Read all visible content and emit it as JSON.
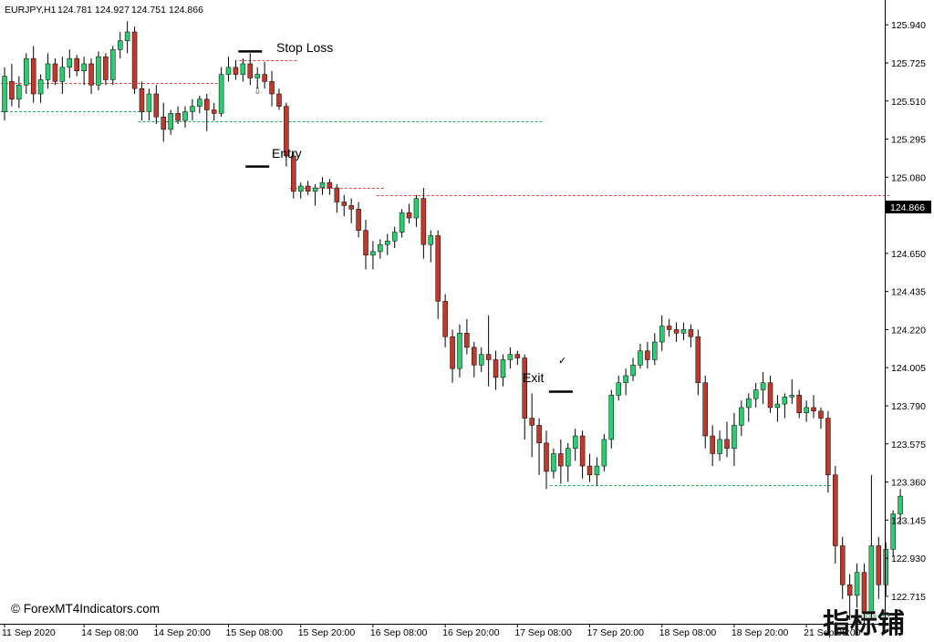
{
  "header": {
    "symbol": "EURJPY,H1",
    "open": "124.781",
    "high": "124.927",
    "low": "124.751",
    "close": "124.866"
  },
  "current_price": "124.866",
  "annotations": {
    "stop_loss": "Stop Loss",
    "entry": "Entry",
    "exit": "Exit"
  },
  "copyright": "© ForexMT4Indicators.com",
  "watermark": "指标铺",
  "colors": {
    "bull": "#2ecc71",
    "bear": "#c0392b",
    "wick": "#000000",
    "resistance_line": "#e74c3c",
    "support_line": "#27ae60",
    "current_price_box": "#000000",
    "background": "#ffffff"
  },
  "chart_data": {
    "type": "candlestick",
    "symbol": "EURJPY",
    "timeframe": "H1",
    "y_tick_labels": [
      "125.940",
      "125.725",
      "125.510",
      "125.295",
      "125.080",
      "124.866",
      "124.650",
      "124.435",
      "124.220",
      "124.005",
      "123.790",
      "123.575",
      "123.360",
      "123.145",
      "122.930",
      "122.715"
    ],
    "y_ticks": [
      125.94,
      125.725,
      125.51,
      125.295,
      125.08,
      124.65,
      124.435,
      124.22,
      124.005,
      123.79,
      123.575,
      123.36,
      123.145,
      122.93,
      122.715
    ],
    "x_tick_labels": [
      "11 Sep 2020",
      "14 Sep 08:00",
      "14 Sep 20:00",
      "15 Sep 08:00",
      "15 Sep 20:00",
      "16 Sep 08:00",
      "16 Sep 20:00",
      "17 Sep 08:00",
      "17 Sep 20:00",
      "18 Sep 08:00",
      "18 Sep 20:00",
      "21 Sep 08:00"
    ],
    "x_tick_bar_index": [
      0,
      11,
      21,
      31,
      41,
      51,
      61,
      71,
      81,
      91,
      101,
      111
    ],
    "ylim": [
      122.56,
      126.08
    ],
    "levels": [
      {
        "kind": "resistance",
        "price": 125.614,
        "from_bar": 0,
        "to_bar": 29
      },
      {
        "kind": "support",
        "price": 125.451,
        "from_bar": 0,
        "to_bar": 19
      },
      {
        "kind": "support",
        "price": 125.398,
        "from_bar": 19,
        "to_bar": 74
      },
      {
        "kind": "resistance",
        "price": 125.74,
        "from_bar": 33,
        "to_bar": 40
      },
      {
        "kind": "resistance",
        "price": 125.018,
        "from_bar": 40,
        "to_bar": 52
      },
      {
        "kind": "resistance",
        "price": 124.98,
        "from_bar": 52,
        "to_bar": 122
      },
      {
        "kind": "support",
        "price": 123.343,
        "from_bar": 76,
        "to_bar": 114
      },
      {
        "kind": "support",
        "price": 122.606,
        "from_bar": 117,
        "to_bar": 122
      }
    ],
    "trade": {
      "stop_loss_bar": 34,
      "stop_loss_price": 125.79,
      "entry_bar": 35,
      "entry_price": 125.14,
      "exit_bar": 77,
      "exit_price": 123.87
    },
    "ohlc": [
      [
        125.45,
        125.7,
        125.4,
        125.65
      ],
      [
        125.62,
        125.72,
        125.48,
        125.52
      ],
      [
        125.52,
        125.65,
        125.47,
        125.6
      ],
      [
        125.6,
        125.78,
        125.55,
        125.75
      ],
      [
        125.75,
        125.82,
        125.5,
        125.55
      ],
      [
        125.55,
        125.66,
        125.5,
        125.63
      ],
      [
        125.63,
        125.78,
        125.58,
        125.72
      ],
      [
        125.72,
        125.75,
        125.6,
        125.62
      ],
      [
        125.62,
        125.76,
        125.55,
        125.7
      ],
      [
        125.7,
        125.8,
        125.64,
        125.75
      ],
      [
        125.75,
        125.77,
        125.65,
        125.68
      ],
      [
        125.68,
        125.76,
        125.6,
        125.72
      ],
      [
        125.72,
        125.75,
        125.55,
        125.6
      ],
      [
        125.6,
        125.79,
        125.57,
        125.76
      ],
      [
        125.76,
        125.78,
        125.6,
        125.63
      ],
      [
        125.63,
        125.82,
        125.6,
        125.8
      ],
      [
        125.8,
        125.9,
        125.75,
        125.85
      ],
      [
        125.85,
        125.96,
        125.78,
        125.9
      ],
      [
        125.9,
        125.93,
        125.55,
        125.58
      ],
      [
        125.58,
        125.62,
        125.4,
        125.45
      ],
      [
        125.45,
        125.58,
        125.4,
        125.55
      ],
      [
        125.55,
        125.6,
        125.38,
        125.42
      ],
      [
        125.42,
        125.5,
        125.28,
        125.35
      ],
      [
        125.35,
        125.46,
        125.32,
        125.44
      ],
      [
        125.44,
        125.48,
        125.38,
        125.4
      ],
      [
        125.4,
        125.48,
        125.36,
        125.45
      ],
      [
        125.45,
        125.52,
        125.4,
        125.48
      ],
      [
        125.48,
        125.54,
        125.44,
        125.52
      ],
      [
        125.52,
        125.55,
        125.34,
        125.46
      ],
      [
        125.46,
        125.5,
        125.4,
        125.44
      ],
      [
        125.44,
        125.7,
        125.42,
        125.66
      ],
      [
        125.66,
        125.76,
        125.62,
        125.7
      ],
      [
        125.7,
        125.74,
        125.63,
        125.66
      ],
      [
        125.66,
        125.75,
        125.62,
        125.72
      ],
      [
        125.72,
        125.78,
        125.6,
        125.64
      ],
      [
        125.64,
        125.7,
        125.58,
        125.66
      ],
      [
        125.66,
        125.73,
        125.58,
        125.62
      ],
      [
        125.62,
        125.68,
        125.48,
        125.55
      ],
      [
        125.55,
        125.58,
        125.46,
        125.48
      ],
      [
        125.48,
        125.5,
        125.14,
        125.2
      ],
      [
        125.2,
        125.22,
        124.96,
        125.0
      ],
      [
        125.0,
        125.05,
        124.96,
        125.03
      ],
      [
        125.03,
        125.06,
        124.98,
        125.0
      ],
      [
        125.0,
        125.04,
        124.92,
        125.02
      ],
      [
        125.02,
        125.08,
        124.98,
        125.05
      ],
      [
        125.05,
        125.07,
        124.98,
        125.02
      ],
      [
        125.02,
        125.04,
        124.88,
        124.94
      ],
      [
        124.94,
        124.98,
        124.86,
        124.92
      ],
      [
        124.92,
        124.96,
        124.82,
        124.9
      ],
      [
        124.9,
        124.94,
        124.74,
        124.78
      ],
      [
        124.78,
        124.84,
        124.56,
        124.64
      ],
      [
        124.64,
        124.72,
        124.56,
        124.66
      ],
      [
        124.66,
        124.73,
        124.62,
        124.7
      ],
      [
        124.7,
        124.76,
        124.64,
        124.72
      ],
      [
        124.72,
        124.8,
        124.68,
        124.77
      ],
      [
        124.77,
        124.9,
        124.74,
        124.88
      ],
      [
        124.88,
        124.93,
        124.82,
        124.85
      ],
      [
        124.85,
        124.98,
        124.8,
        124.96
      ],
      [
        124.96,
        125.02,
        124.62,
        124.7
      ],
      [
        124.7,
        124.78,
        124.6,
        124.75
      ],
      [
        124.75,
        124.78,
        124.28,
        124.38
      ],
      [
        124.38,
        124.42,
        124.12,
        124.18
      ],
      [
        124.18,
        124.22,
        123.92,
        124.0
      ],
      [
        124.0,
        124.25,
        123.95,
        124.2
      ],
      [
        124.2,
        124.28,
        124.08,
        124.12
      ],
      [
        124.12,
        124.15,
        123.95,
        124.02
      ],
      [
        124.02,
        124.12,
        123.98,
        124.08
      ],
      [
        124.08,
        124.3,
        123.9,
        124.05
      ],
      [
        124.05,
        124.1,
        123.88,
        123.95
      ],
      [
        123.95,
        124.08,
        123.9,
        124.05
      ],
      [
        124.05,
        124.12,
        124.0,
        124.08
      ],
      [
        124.08,
        124.1,
        124.02,
        124.06
      ],
      [
        124.06,
        124.08,
        123.6,
        123.72
      ],
      [
        123.72,
        123.86,
        123.5,
        123.68
      ],
      [
        123.68,
        123.72,
        123.4,
        123.58
      ],
      [
        123.58,
        123.65,
        123.32,
        123.42
      ],
      [
        123.42,
        123.55,
        123.38,
        123.52
      ],
      [
        123.52,
        123.6,
        123.35,
        123.45
      ],
      [
        123.45,
        123.58,
        123.36,
        123.55
      ],
      [
        123.55,
        123.66,
        123.48,
        123.62
      ],
      [
        123.62,
        123.65,
        123.38,
        123.45
      ],
      [
        123.45,
        123.52,
        123.36,
        123.4
      ],
      [
        123.4,
        123.5,
        123.34,
        123.45
      ],
      [
        123.45,
        123.63,
        123.42,
        123.6
      ],
      [
        123.6,
        123.88,
        123.55,
        123.85
      ],
      [
        123.85,
        123.96,
        123.82,
        123.92
      ],
      [
        123.92,
        124.0,
        123.85,
        123.96
      ],
      [
        123.96,
        124.06,
        123.93,
        124.02
      ],
      [
        124.02,
        124.14,
        124.0,
        124.1
      ],
      [
        124.1,
        124.15,
        124.0,
        124.05
      ],
      [
        124.05,
        124.2,
        124.02,
        124.15
      ],
      [
        124.15,
        124.3,
        124.1,
        124.24
      ],
      [
        124.24,
        124.28,
        124.18,
        124.22
      ],
      [
        124.22,
        124.26,
        124.15,
        124.2
      ],
      [
        124.2,
        124.26,
        124.16,
        124.22
      ],
      [
        124.22,
        124.25,
        124.12,
        124.18
      ],
      [
        124.18,
        124.22,
        123.85,
        123.92
      ],
      [
        123.92,
        123.96,
        123.55,
        123.62
      ],
      [
        123.62,
        123.68,
        123.45,
        123.52
      ],
      [
        123.52,
        123.65,
        123.48,
        123.6
      ],
      [
        123.6,
        123.7,
        123.5,
        123.55
      ],
      [
        123.55,
        123.75,
        123.45,
        123.68
      ],
      [
        123.68,
        123.82,
        123.62,
        123.78
      ],
      [
        123.78,
        123.86,
        123.7,
        123.83
      ],
      [
        123.83,
        123.92,
        123.78,
        123.88
      ],
      [
        123.88,
        123.98,
        123.8,
        123.92
      ],
      [
        123.92,
        123.96,
        123.75,
        123.78
      ],
      [
        123.78,
        123.85,
        123.7,
        123.8
      ],
      [
        123.8,
        123.86,
        123.72,
        123.84
      ],
      [
        123.84,
        123.94,
        123.8,
        123.85
      ],
      [
        123.85,
        123.88,
        123.72,
        123.75
      ],
      [
        123.75,
        123.82,
        123.7,
        123.78
      ],
      [
        123.78,
        123.85,
        123.72,
        123.76
      ],
      [
        123.76,
        123.78,
        123.66,
        123.72
      ],
      [
        123.72,
        123.76,
        123.3,
        123.4
      ],
      [
        123.4,
        123.45,
        122.9,
        123.0
      ],
      [
        123.0,
        123.05,
        122.7,
        122.78
      ],
      [
        122.78,
        122.84,
        122.58,
        122.72
      ],
      [
        122.72,
        122.9,
        122.65,
        122.85
      ],
      [
        122.85,
        122.9,
        122.56,
        122.62
      ],
      [
        122.62,
        123.4,
        122.58,
        123.0
      ],
      [
        123.0,
        123.05,
        122.7,
        122.78
      ],
      [
        122.78,
        123.02,
        122.72,
        122.98
      ],
      [
        122.98,
        123.2,
        122.94,
        123.18
      ],
      [
        123.18,
        123.32,
        123.12,
        123.28
      ]
    ]
  }
}
